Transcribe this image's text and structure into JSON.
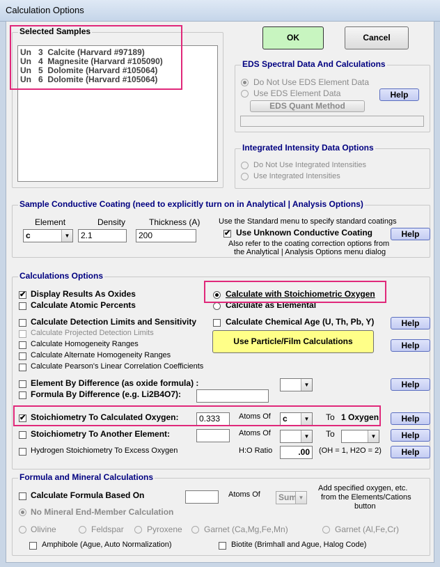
{
  "window": {
    "title": "Calculation Options"
  },
  "buttons": {
    "ok": "OK",
    "cancel": "Cancel",
    "help": "Help",
    "eds_quant": "EDS Quant Method",
    "particle_film": "Use Particle/Film Calculations"
  },
  "samples": {
    "title": "Selected Samples",
    "items": [
      "Un   3  Calcite (Harvard #97189)",
      "Un   4  Magnesite (Harvard #105090)",
      "Un   5  Dolomite (Harvard #105064)",
      "Un   6  Dolomite (Harvard #105064)"
    ]
  },
  "eds": {
    "title": "EDS Spectral Data And Calculations",
    "opt_no": "Do Not Use EDS Element Data",
    "opt_use": "Use EDS Element Data"
  },
  "integrated": {
    "title": "Integrated Intensity Data Options",
    "opt_no": "Do Not Use Integrated Intensities",
    "opt_use": "Use Integrated Intensities"
  },
  "coating": {
    "title": "Sample Conductive Coating (need to explicitly turn on in Analytical | Analysis Options)",
    "element_label": "Element",
    "density_label": "Density",
    "thickness_label": "Thickness (A)",
    "element_value": "c",
    "density_value": "2.1",
    "thickness_value": "200",
    "note1": "Use the Standard menu to specify standard coatings",
    "use_unknown": "Use Unknown Conductive Coating",
    "note2": "Also refer to the coating correction options from",
    "note3": "the Analytical | Analysis Options menu dialog"
  },
  "calc": {
    "title": "Calculations Options",
    "display_oxides": "Display Results As Oxides",
    "atomic_percents": "Calculate Atomic Percents",
    "stoich_oxygen": "Calculate with Stoichiometric Oxygen",
    "as_elemental": "Calculate as Elemental",
    "detection_limits": "Calculate Detection Limits and Sensitivity",
    "projected_limits": "Calculate Projected Detection Limits",
    "homogeneity": "Calculate Homogeneity Ranges",
    "alt_homogeneity": "Calculate Alternate Homogeneity Ranges",
    "pearson": "Calculate Pearson's Linear Correlation Coefficients",
    "chemical_age": "Calculate Chemical Age (U, Th, Pb, Y)",
    "element_by_diff": "Element By Difference (as oxide formula) :",
    "formula_by_diff": "Formula By Difference (e.g. Li2B4O7):",
    "stoich_calc_oxygen": "Stoichiometry To Calculated Oxygen:",
    "stoich_value": "0.333",
    "atoms_of": "Atoms Of",
    "stoich_element": "c",
    "to": "To",
    "one_oxygen": "1 Oxygen",
    "stoich_another": "Stoichiometry To Another Element:",
    "hydrogen": "Hydrogen Stoichiometry To Excess Oxygen",
    "ho_ratio": "H:O Ratio",
    "ho_value": ".00",
    "ho_note": "(OH = 1, H2O = 2)"
  },
  "formula": {
    "title": "Formula and Mineral Calculations",
    "calc_formula": "Calculate Formula Based On",
    "atoms_of": "Atoms Of",
    "sum_value": "Sum",
    "note1": "Add specified oxygen, etc.",
    "note2": "from the Elements/Cations",
    "note3": "button",
    "no_mineral": "No Mineral End-Member Calculation",
    "olivine": "Olivine",
    "feldspar": "Feldspar",
    "pyroxene": "Pyroxene",
    "garnet1": "Garnet (Ca,Mg,Fe,Mn)",
    "garnet2": "Garnet (Al,Fe,Cr)",
    "amphibole": "Amphibole (Ague, Auto Normalization)",
    "biotite": "Biotite (Brimhall and Ague, Halog Code)"
  },
  "colors": {
    "legend": "#000080",
    "ok": "#c8f5c0",
    "particle": "#ffff88",
    "highlight": "#e0287a"
  },
  "icons": {
    "check": "✔",
    "arrow": "▼"
  }
}
